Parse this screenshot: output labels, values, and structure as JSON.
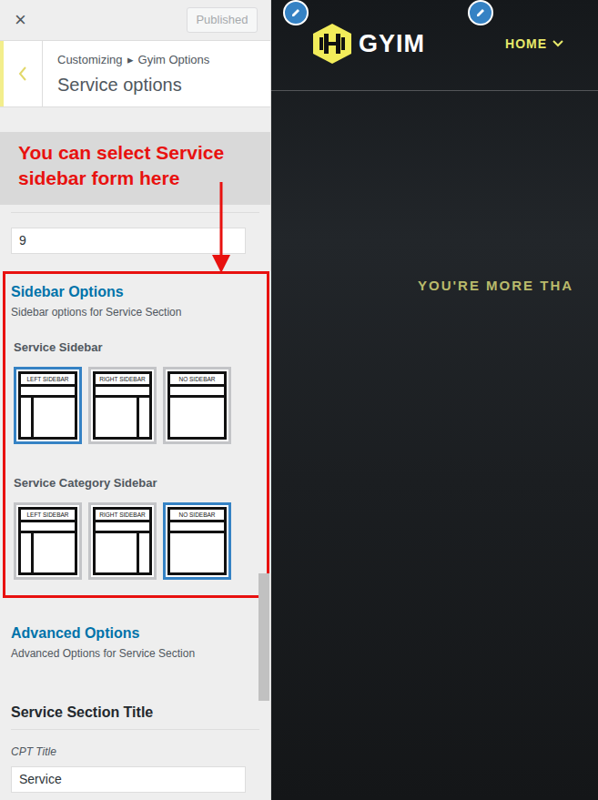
{
  "topbar": {
    "close_icon": "×",
    "publish_button": {
      "label": "Published",
      "disabled": true
    }
  },
  "header": {
    "breadcrumb": [
      "Customizing",
      "▸",
      "Gyim Options"
    ],
    "title": "Service options"
  },
  "annotation": {
    "text": "You can select Service sidebar form here"
  },
  "number_field": {
    "value": "9"
  },
  "sidebar_section": {
    "title": "Sidebar Options",
    "description": "Sidebar options for Service Section",
    "groups": [
      {
        "label": "Service Sidebar",
        "choices": [
          {
            "label": "LEFT SIDEBAR",
            "kind": "left",
            "selected": true
          },
          {
            "label": "RIGHT SIDEBAR",
            "kind": "right",
            "selected": false
          },
          {
            "label": "NO SIDEBAR",
            "kind": "none",
            "selected": false
          }
        ]
      },
      {
        "label": "Service Category Sidebar",
        "choices": [
          {
            "label": "LEFT SIDEBAR",
            "kind": "left",
            "selected": false
          },
          {
            "label": "RIGHT SIDEBAR",
            "kind": "right",
            "selected": false
          },
          {
            "label": "NO SIDEBAR",
            "kind": "none",
            "selected": true
          }
        ]
      }
    ]
  },
  "advanced_section": {
    "title": "Advanced Options",
    "description": "Advanced Options for Service Section"
  },
  "title_field": {
    "heading": "Service Section Title",
    "label": "CPT Title",
    "value": "Service"
  },
  "preview": {
    "logo_text": "GYIM",
    "nav": [
      {
        "label": "HOME",
        "selected": true
      }
    ],
    "hero_text": "YOU'RE MORE THA"
  }
}
